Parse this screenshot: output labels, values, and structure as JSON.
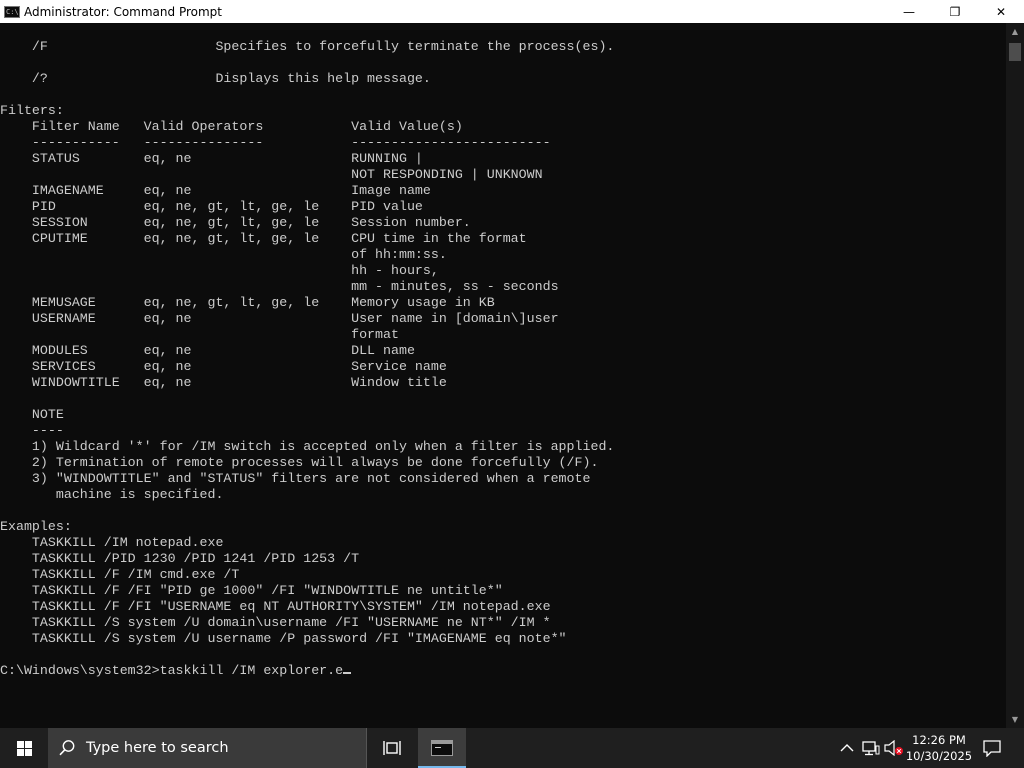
{
  "window": {
    "title": "Administrator: Command Prompt",
    "app_icon_glyph": "C:\\",
    "minimize_glyph": "—",
    "restore_glyph": "❐",
    "close_glyph": "✕"
  },
  "console": {
    "text": "    /F                     Specifies to forcefully terminate the process(es).\n\n    /?                     Displays this help message.\n\nFilters:\n    Filter Name   Valid Operators           Valid Value(s)\n    -----------   ---------------           -------------------------\n    STATUS        eq, ne                    RUNNING |\n                                            NOT RESPONDING | UNKNOWN\n    IMAGENAME     eq, ne                    Image name\n    PID           eq, ne, gt, lt, ge, le    PID value\n    SESSION       eq, ne, gt, lt, ge, le    Session number.\n    CPUTIME       eq, ne, gt, lt, ge, le    CPU time in the format\n                                            of hh:mm:ss.\n                                            hh - hours,\n                                            mm - minutes, ss - seconds\n    MEMUSAGE      eq, ne, gt, lt, ge, le    Memory usage in KB\n    USERNAME      eq, ne                    User name in [domain\\]user\n                                            format\n    MODULES       eq, ne                    DLL name\n    SERVICES      eq, ne                    Service name\n    WINDOWTITLE   eq, ne                    Window title\n\n    NOTE\n    ----\n    1) Wildcard '*' for /IM switch is accepted only when a filter is applied.\n    2) Termination of remote processes will always be done forcefully (/F).\n    3) \"WINDOWTITLE\" and \"STATUS\" filters are not considered when a remote\n       machine is specified.\n\nExamples:\n    TASKKILL /IM notepad.exe\n    TASKKILL /PID 1230 /PID 1241 /PID 1253 /T\n    TASKKILL /F /IM cmd.exe /T\n    TASKKILL /F /FI \"PID ge 1000\" /FI \"WINDOWTITLE ne untitle*\"\n    TASKKILL /F /FI \"USERNAME eq NT AUTHORITY\\SYSTEM\" /IM notepad.exe\n    TASKKILL /S system /U domain\\username /FI \"USERNAME ne NT*\" /IM *\n    TASKKILL /S system /U username /P password /FI \"IMAGENAME eq note*\"\n\n",
    "prompt": "C:\\Windows\\system32>",
    "command_input": "taskkill /IM explorer.e"
  },
  "taskbar": {
    "search_placeholder": "Type here to search",
    "time": "12:26 PM",
    "date": "10/30/2025"
  },
  "colors": {
    "console_bg": "#0c0c0c",
    "console_fg": "#cccccc",
    "taskbar_bg": "#1f1f1f",
    "accent": "#76b9ed"
  },
  "icons": {
    "app": "cmd-icon",
    "start": "windows-logo-icon",
    "search": "search-icon",
    "task_view": "task-view-icon",
    "tray_chevron": "chevron-up-icon",
    "network": "network-icon",
    "volume": "volume-muted-icon",
    "notifications": "notification-icon"
  }
}
